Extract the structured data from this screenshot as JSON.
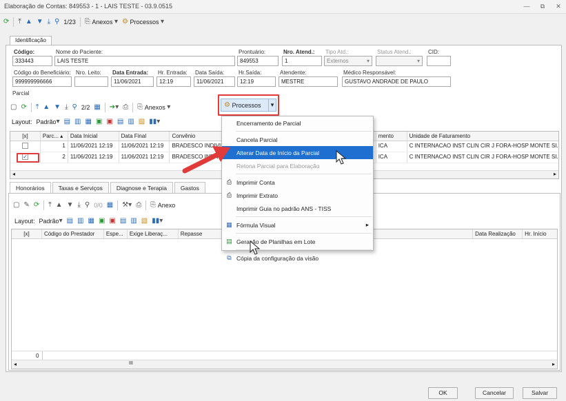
{
  "window": {
    "title": "Elaboração de Contas: 849553 - 1 - LAIS TESTE - 03.9.0515",
    "min": "—",
    "restore": "⧉",
    "close": "✕"
  },
  "toolbar": {
    "counter": "1/23",
    "anexos": "Anexos",
    "processos": "Processos"
  },
  "tab_identificacao": "Identificação",
  "fields": {
    "codigo_label": "Código:",
    "codigo": "333443",
    "nome_label": "Nome do Paciente:",
    "nome": "LAIS TESTE",
    "prontuario_label": "Prontuário:",
    "prontuario": "849553",
    "nro_atend_label": "Nro. Atend.:",
    "nro_atend": "1",
    "tipo_atd_label": "Tipo Atd.:",
    "tipo_atd": "Externos",
    "status_atend_label": "Status Atend.:",
    "status_atend": "",
    "cid_label": "CID:",
    "cid": "",
    "cod_benef_label": "Código do Beneficiário:",
    "cod_benef": "999999996666",
    "nro_leito_label": "Nro. Leito:",
    "nro_leito": "",
    "data_entrada_label": "Data Entrada:",
    "data_entrada": "11/06/2021",
    "hr_entrada_label": "Hr. Entrada:",
    "hr_entrada": "12:19",
    "data_saida_label": "Data Saída:",
    "data_saida": "11/06/2021",
    "hr_saida_label": "Hr.Saída:",
    "hr_saida": "12:19",
    "atendente_label": "Atendente:",
    "atendente": "MESTRE",
    "medico_label": "Médico Responsável:",
    "medico": "GUSTAVO ANDRADE DE PAULO"
  },
  "parcial": {
    "section": "Parcial",
    "counter": "2/2",
    "anexos": "Anexos",
    "processos": "Processos",
    "layout_label": "Layout:",
    "padrao": "Padrão",
    "columns": [
      "[x]",
      "Parc...",
      "Data Inicial",
      "Data Final",
      "Convênio",
      "mento",
      "Unidade de Faturamento"
    ],
    "rows": [
      {
        "checked": false,
        "num": "1",
        "inicio": "11/06/2021 12:19",
        "fim": "11/06/2021 12:19",
        "convenio": "BRADESCO INDIVIDU...",
        "tipo": "ICA",
        "unidade": "C INTERNACAO INST CLIN CIR J FORA-HOSP MONTE SI..."
      },
      {
        "checked": true,
        "num": "2",
        "inicio": "11/06/2021 12:19",
        "fim": "11/06/2021 12:19",
        "convenio": "BRADESCO INDIVIDU...",
        "tipo": "ICA",
        "unidade": "C INTERNACAO INST CLIN CIR J FORA-HOSP MONTE SI..."
      }
    ]
  },
  "menu": {
    "items": [
      "Encerramento de Parcial",
      "Cancela Parcial",
      "Alterar Data de Início da Parcial",
      "Retona Parcial para Elaboração",
      "Imprimir Conta",
      "Imprimir Extrato",
      "Imprimir Guia no padrão ANS - TISS",
      "Fórmula Visual",
      "Geração de Planilhas em Lote",
      "Cópia da configuração da visão"
    ],
    "submenu_arrow": "▸"
  },
  "subtabs": [
    "Honorários",
    "Taxas e Serviços",
    "Diagnose e Terapia",
    "Gastos"
  ],
  "lower": {
    "counter": "0/0",
    "anexos": "Anexo",
    "layout_label": "Layout:",
    "padrao": "Padrão",
    "columns": [
      "[x]",
      "Código do Prestador",
      "Espe...",
      "Exige Liberaç...",
      "Repasse",
      "Data Realização",
      "Hr. Início"
    ],
    "footer_count": "0",
    "scroll_mark": "III"
  },
  "buttons": {
    "ok": "OK",
    "cancelar": "Cancelar",
    "salvar": "Salvar"
  },
  "colors": {
    "highlight": "#1e6fd0",
    "annotation_red": "#e03a3a"
  }
}
